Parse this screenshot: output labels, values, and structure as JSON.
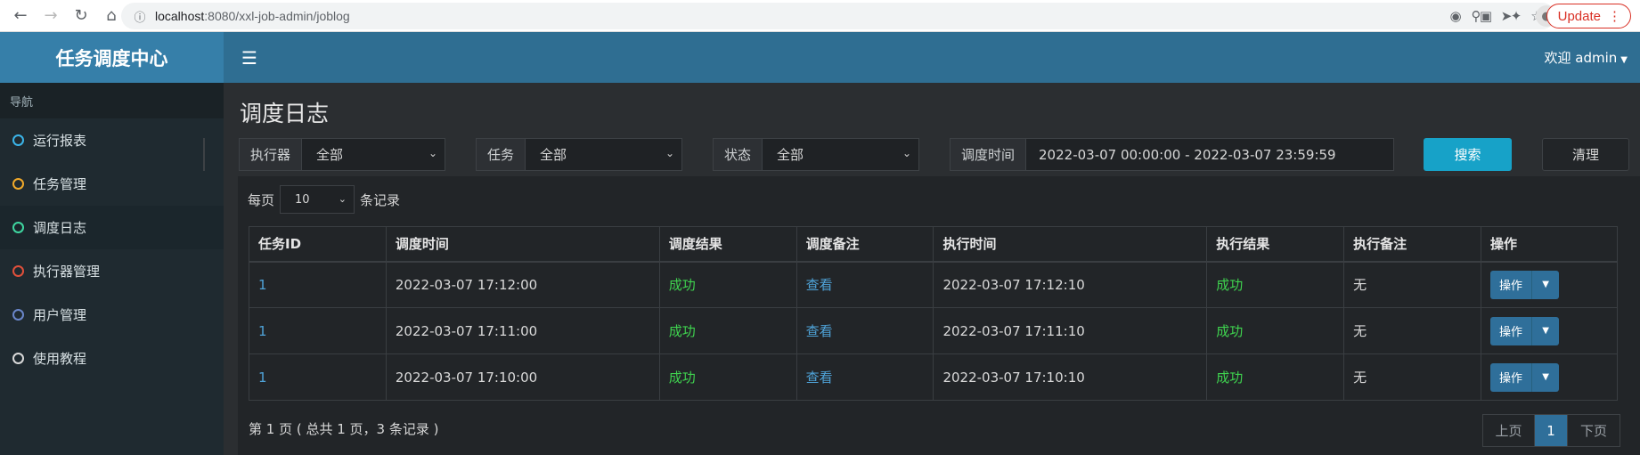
{
  "browser": {
    "url_host": "localhost",
    "url_rest": ":8080/xxl-job-admin/joblog",
    "update_label": "Update"
  },
  "app": {
    "logo": "任务调度中心",
    "welcome": "欢迎 admin"
  },
  "sidebar": {
    "header": "导航",
    "items": [
      {
        "label": "运行报表",
        "color": "#3bb4e8"
      },
      {
        "label": "任务管理",
        "color": "#f0a92a"
      },
      {
        "label": "调度日志",
        "color": "#3fd6a0"
      },
      {
        "label": "执行器管理",
        "color": "#e0503b"
      },
      {
        "label": "用户管理",
        "color": "#6a86c9"
      },
      {
        "label": "使用教程",
        "color": "#d9d9d9"
      }
    ]
  },
  "main": {
    "title": "调度日志",
    "filters": {
      "executor_label": "执行器",
      "executor_value": "全部",
      "job_label": "任务",
      "job_value": "全部",
      "status_label": "状态",
      "status_value": "全部",
      "time_label": "调度时间",
      "time_value": "2022-03-07 00:00:00 - 2022-03-07 23:59:59",
      "search": "搜索",
      "clear": "清理"
    },
    "per_page_prefix": "每页",
    "per_page_value": "10",
    "per_page_suffix": "条记录",
    "table": {
      "headers": [
        "任务ID",
        "调度时间",
        "调度结果",
        "调度备注",
        "执行时间",
        "执行结果",
        "执行备注",
        "操作"
      ],
      "rows": [
        {
          "id": "1",
          "trigger_time": "2022-03-07 17:12:00",
          "trigger_result": "成功",
          "trigger_note": "查看",
          "exec_time": "2022-03-07 17:12:10",
          "exec_result": "成功",
          "exec_note": "无",
          "op": "操作"
        },
        {
          "id": "1",
          "trigger_time": "2022-03-07 17:11:00",
          "trigger_result": "成功",
          "trigger_note": "查看",
          "exec_time": "2022-03-07 17:11:10",
          "exec_result": "成功",
          "exec_note": "无",
          "op": "操作"
        },
        {
          "id": "1",
          "trigger_time": "2022-03-07 17:10:00",
          "trigger_result": "成功",
          "trigger_note": "查看",
          "exec_time": "2022-03-07 17:10:10",
          "exec_result": "成功",
          "exec_note": "无",
          "op": "操作"
        }
      ]
    },
    "page_info": "第 1 页 ( 总共 1 页，3 条记录 )",
    "pager": {
      "prev": "上页",
      "current": "1",
      "next": "下页"
    }
  }
}
